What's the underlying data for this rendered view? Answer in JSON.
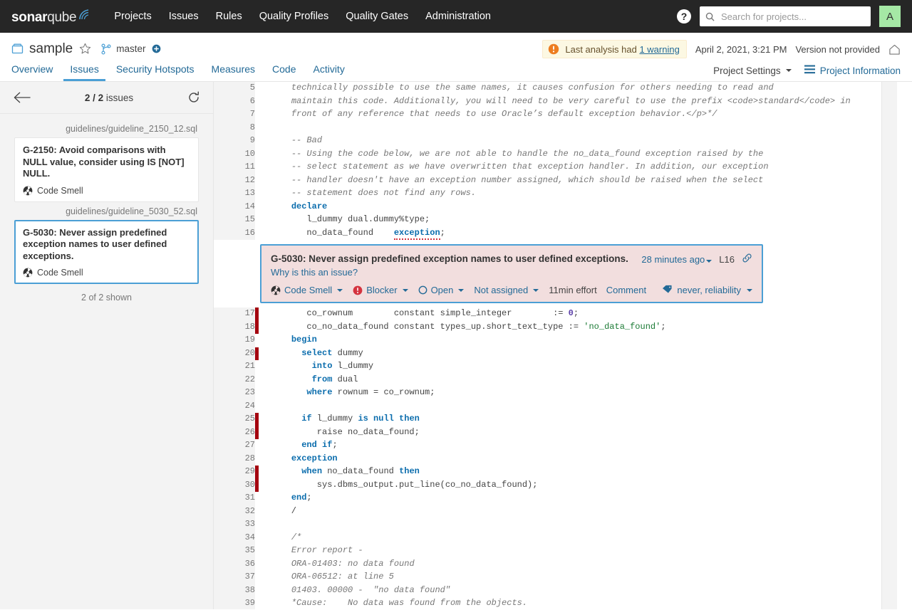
{
  "topnav": {
    "logo": {
      "bold": "sonar",
      "light": "qube"
    },
    "links": [
      "Projects",
      "Issues",
      "Rules",
      "Quality Profiles",
      "Quality Gates",
      "Administration"
    ],
    "help_icon": "help-circle-icon",
    "search": {
      "placeholder": "Search for projects...",
      "value": "",
      "icon": "search-icon"
    },
    "avatar": {
      "initial": "A",
      "color": "#a5e8a5"
    },
    "background": "#262626"
  },
  "project": {
    "icon": "project-icon",
    "name": "sample",
    "favorite_icon": "star-icon",
    "branch_icon": "branch-icon",
    "branch": "master",
    "branch_add_icon": "plus-circle-icon",
    "warning": {
      "icon": "warning-icon",
      "text_prefix": "Last analysis had ",
      "link": "1 warning"
    },
    "analysis_date": "April 2, 2021, 3:21 PM",
    "version": "Version not provided",
    "home_icon": "home-icon",
    "tabs": [
      {
        "label": "Overview",
        "active": false
      },
      {
        "label": "Issues",
        "active": true
      },
      {
        "label": "Security Hotspots",
        "active": false
      },
      {
        "label": "Measures",
        "active": false
      },
      {
        "label": "Code",
        "active": false
      },
      {
        "label": "Activity",
        "active": false
      }
    ],
    "settings_label": "Project Settings",
    "information_label": "Project Information",
    "information_icon": "list-icon"
  },
  "sidebar": {
    "back_icon": "arrow-left-icon",
    "count_current": "2",
    "count_separator": " / ",
    "count_total": "2",
    "count_suffix": " issues",
    "reload_icon": "refresh-icon",
    "groups": [
      {
        "file": "guidelines/guideline_2150_12.sql",
        "issue": {
          "message": "G-2150: Avoid comparisons with NULL value, consider using IS [NOT] NULL.",
          "type": "Code Smell",
          "type_icon": "code-smell-icon",
          "selected": false
        }
      },
      {
        "file": "guidelines/guideline_5030_52.sql",
        "issue": {
          "message": "G-5030: Never assign predefined exception names to user defined exceptions.",
          "type": "Code Smell",
          "type_icon": "code-smell-icon",
          "selected": true
        }
      }
    ],
    "footer": "2 of 2 shown"
  },
  "issue_detail": {
    "title": "G-5030: Never assign predefined exception names to user defined exceptions.",
    "why_link": "Why is this an issue?",
    "date": "28 minutes ago",
    "line": "L16",
    "permalink_icon": "link-icon",
    "type": "Code Smell",
    "type_icon": "code-smell-icon",
    "severity": "Blocker",
    "severity_icon": "blocker-icon",
    "status": "Open",
    "status_icon": "open-circle-icon",
    "assignee": "Not assigned",
    "effort": "11min effort",
    "comment_label": "Comment",
    "tags_icon": "tag-icon",
    "tags": "never, reliability",
    "border_color": "#4b9fd5",
    "background_color": "#f2dede"
  },
  "code": {
    "lines": [
      {
        "n": "5",
        "cover": "none",
        "tokens": [
          {
            "t": "    ",
            "c": ""
          },
          {
            "t": "technically possible to use the same names, it causes confusion for others needing to read and",
            "c": "cm"
          }
        ]
      },
      {
        "n": "6",
        "cover": "none",
        "tokens": [
          {
            "t": "    ",
            "c": ""
          },
          {
            "t": "maintain this code. Additionally, you will need to be very careful to use the prefix <code>standard</code> in",
            "c": "cm"
          }
        ]
      },
      {
        "n": "7",
        "cover": "none",
        "tokens": [
          {
            "t": "    ",
            "c": ""
          },
          {
            "t": "front of any reference that needs to use Oracle’s default exception behavior.</p>*/",
            "c": "cm"
          }
        ]
      },
      {
        "n": "8",
        "cover": "none",
        "tokens": []
      },
      {
        "n": "9",
        "cover": "none",
        "tokens": [
          {
            "t": "    ",
            "c": ""
          },
          {
            "t": "-- Bad",
            "c": "cm"
          }
        ]
      },
      {
        "n": "10",
        "cover": "none",
        "tokens": [
          {
            "t": "    ",
            "c": ""
          },
          {
            "t": "-- Using the code below, we are not able to handle the no_data_found exception raised by the",
            "c": "cm"
          }
        ]
      },
      {
        "n": "11",
        "cover": "none",
        "tokens": [
          {
            "t": "    ",
            "c": ""
          },
          {
            "t": "-- select statement as we have overwritten that exception handler. In addition, our exception",
            "c": "cm"
          }
        ]
      },
      {
        "n": "12",
        "cover": "none",
        "tokens": [
          {
            "t": "    ",
            "c": ""
          },
          {
            "t": "-- handler doesn't have an exception number assigned, which should be raised when the select",
            "c": "cm"
          }
        ]
      },
      {
        "n": "13",
        "cover": "none",
        "tokens": [
          {
            "t": "    ",
            "c": ""
          },
          {
            "t": "-- statement does not find any rows.",
            "c": "cm"
          }
        ]
      },
      {
        "n": "14",
        "cover": "none",
        "tokens": [
          {
            "t": "    ",
            "c": ""
          },
          {
            "t": "declare",
            "c": "k"
          }
        ]
      },
      {
        "n": "15",
        "cover": "none",
        "tokens": [
          {
            "t": "       l_dummy dual.dummy%type;",
            "c": ""
          }
        ]
      },
      {
        "n": "16",
        "cover": "none",
        "underline": true,
        "tokens": [
          {
            "t": "       no_data_found    ",
            "c": ""
          },
          {
            "t": "exception",
            "c": "k"
          },
          {
            "t": ";",
            "c": ""
          }
        ]
      }
    ],
    "lines_after": [
      {
        "n": "17",
        "cover": "uncovered",
        "tokens": [
          {
            "t": "       co_rownum        constant simple_integer        := ",
            "c": ""
          },
          {
            "t": "0",
            "c": "cn"
          },
          {
            "t": ";",
            "c": ""
          }
        ]
      },
      {
        "n": "18",
        "cover": "uncovered",
        "tokens": [
          {
            "t": "       co_no_data_found constant types_up.short_text_type := ",
            "c": ""
          },
          {
            "t": "'no_data_found'",
            "c": "st"
          },
          {
            "t": ";",
            "c": ""
          }
        ]
      },
      {
        "n": "19",
        "cover": "none",
        "tokens": [
          {
            "t": "    ",
            "c": ""
          },
          {
            "t": "begin",
            "c": "k"
          }
        ]
      },
      {
        "n": "20",
        "cover": "uncovered",
        "tokens": [
          {
            "t": "      ",
            "c": ""
          },
          {
            "t": "select",
            "c": "k"
          },
          {
            "t": " dummy",
            "c": ""
          }
        ]
      },
      {
        "n": "21",
        "cover": "none",
        "tokens": [
          {
            "t": "        ",
            "c": ""
          },
          {
            "t": "into",
            "c": "k"
          },
          {
            "t": " l_dummy",
            "c": ""
          }
        ]
      },
      {
        "n": "22",
        "cover": "none",
        "tokens": [
          {
            "t": "        ",
            "c": ""
          },
          {
            "t": "from",
            "c": "k"
          },
          {
            "t": " dual",
            "c": ""
          }
        ]
      },
      {
        "n": "23",
        "cover": "none",
        "tokens": [
          {
            "t": "       ",
            "c": ""
          },
          {
            "t": "where",
            "c": "k"
          },
          {
            "t": " rownum = co_rownum;",
            "c": ""
          }
        ]
      },
      {
        "n": "24",
        "cover": "none",
        "tokens": []
      },
      {
        "n": "25",
        "cover": "uncovered",
        "tokens": [
          {
            "t": "      ",
            "c": ""
          },
          {
            "t": "if",
            "c": "k"
          },
          {
            "t": " l_dummy ",
            "c": ""
          },
          {
            "t": "is null then",
            "c": "k"
          }
        ]
      },
      {
        "n": "26",
        "cover": "uncovered",
        "tokens": [
          {
            "t": "         raise no_data_found;",
            "c": ""
          }
        ]
      },
      {
        "n": "27",
        "cover": "none",
        "tokens": [
          {
            "t": "      ",
            "c": ""
          },
          {
            "t": "end if",
            "c": "k"
          },
          {
            "t": ";",
            "c": ""
          }
        ]
      },
      {
        "n": "28",
        "cover": "none",
        "tokens": [
          {
            "t": "    ",
            "c": ""
          },
          {
            "t": "exception",
            "c": "k"
          }
        ]
      },
      {
        "n": "29",
        "cover": "uncovered",
        "tokens": [
          {
            "t": "      ",
            "c": ""
          },
          {
            "t": "when",
            "c": "k"
          },
          {
            "t": " no_data_found ",
            "c": ""
          },
          {
            "t": "then",
            "c": "k"
          }
        ]
      },
      {
        "n": "30",
        "cover": "uncovered",
        "tokens": [
          {
            "t": "         sys.dbms_output.put_line(co_no_data_found);",
            "c": ""
          }
        ]
      },
      {
        "n": "31",
        "cover": "none",
        "tokens": [
          {
            "t": "    ",
            "c": ""
          },
          {
            "t": "end",
            "c": "k"
          },
          {
            "t": ";",
            "c": ""
          }
        ]
      },
      {
        "n": "32",
        "cover": "none",
        "tokens": [
          {
            "t": "    /",
            "c": ""
          }
        ]
      },
      {
        "n": "33",
        "cover": "none",
        "tokens": []
      },
      {
        "n": "34",
        "cover": "none",
        "tokens": [
          {
            "t": "    ",
            "c": ""
          },
          {
            "t": "/*",
            "c": "cm"
          }
        ]
      },
      {
        "n": "35",
        "cover": "none",
        "tokens": [
          {
            "t": "    ",
            "c": ""
          },
          {
            "t": "Error report -",
            "c": "cm"
          }
        ]
      },
      {
        "n": "36",
        "cover": "none",
        "tokens": [
          {
            "t": "    ",
            "c": ""
          },
          {
            "t": "ORA-01403: no data found",
            "c": "cm"
          }
        ]
      },
      {
        "n": "37",
        "cover": "none",
        "tokens": [
          {
            "t": "    ",
            "c": ""
          },
          {
            "t": "ORA-06512: at line 5",
            "c": "cm"
          }
        ]
      },
      {
        "n": "38",
        "cover": "none",
        "tokens": [
          {
            "t": "    ",
            "c": ""
          },
          {
            "t": "01403. 00000 -  \"no data found\"",
            "c": "cm"
          }
        ]
      },
      {
        "n": "39",
        "cover": "none",
        "tokens": [
          {
            "t": "    ",
            "c": ""
          },
          {
            "t": "*Cause:    No data was found from the objects.",
            "c": "cm"
          }
        ]
      }
    ]
  }
}
